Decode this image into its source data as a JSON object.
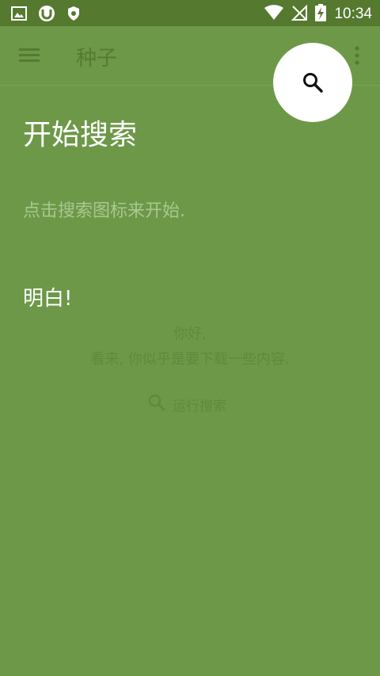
{
  "status_bar": {
    "time": "10:34",
    "left_icons": [
      "gallery-icon",
      "utorrent-icon",
      "shield-icon"
    ],
    "right_icons": [
      "wifi-icon",
      "signal-icon",
      "battery-charging-icon"
    ]
  },
  "app_bar": {
    "title": "种子",
    "menu_icon": "menu-icon",
    "search_icon": "search-icon",
    "more_icon": "more-vert-icon"
  },
  "tip": {
    "title": "开始搜索",
    "description": "点击搜索图标来开始.",
    "dismiss_label": "明白!"
  },
  "empty_state": {
    "greeting": "你好,",
    "message": "看来, 你似乎是要下载一些内容.",
    "action_label": "运行搜索"
  },
  "colors": {
    "status_bar": "#55792f",
    "background": "#6d9848",
    "spotlight": "#ffffff",
    "muted_text": "#5f8a3c"
  }
}
